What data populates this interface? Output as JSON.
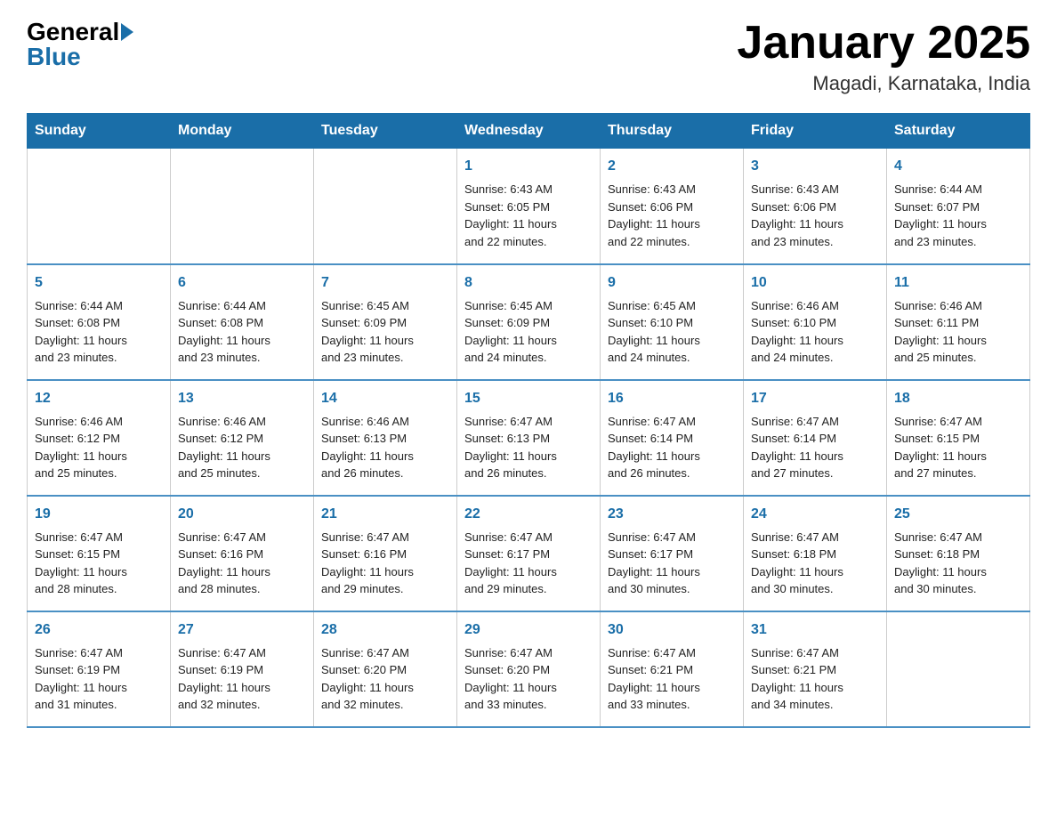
{
  "header": {
    "logo_general": "General",
    "logo_blue": "Blue",
    "month_title": "January 2025",
    "location": "Magadi, Karnataka, India"
  },
  "weekdays": [
    "Sunday",
    "Monday",
    "Tuesday",
    "Wednesday",
    "Thursday",
    "Friday",
    "Saturday"
  ],
  "weeks": [
    [
      {
        "day": "",
        "info": ""
      },
      {
        "day": "",
        "info": ""
      },
      {
        "day": "",
        "info": ""
      },
      {
        "day": "1",
        "info": "Sunrise: 6:43 AM\nSunset: 6:05 PM\nDaylight: 11 hours\nand 22 minutes."
      },
      {
        "day": "2",
        "info": "Sunrise: 6:43 AM\nSunset: 6:06 PM\nDaylight: 11 hours\nand 22 minutes."
      },
      {
        "day": "3",
        "info": "Sunrise: 6:43 AM\nSunset: 6:06 PM\nDaylight: 11 hours\nand 23 minutes."
      },
      {
        "day": "4",
        "info": "Sunrise: 6:44 AM\nSunset: 6:07 PM\nDaylight: 11 hours\nand 23 minutes."
      }
    ],
    [
      {
        "day": "5",
        "info": "Sunrise: 6:44 AM\nSunset: 6:08 PM\nDaylight: 11 hours\nand 23 minutes."
      },
      {
        "day": "6",
        "info": "Sunrise: 6:44 AM\nSunset: 6:08 PM\nDaylight: 11 hours\nand 23 minutes."
      },
      {
        "day": "7",
        "info": "Sunrise: 6:45 AM\nSunset: 6:09 PM\nDaylight: 11 hours\nand 23 minutes."
      },
      {
        "day": "8",
        "info": "Sunrise: 6:45 AM\nSunset: 6:09 PM\nDaylight: 11 hours\nand 24 minutes."
      },
      {
        "day": "9",
        "info": "Sunrise: 6:45 AM\nSunset: 6:10 PM\nDaylight: 11 hours\nand 24 minutes."
      },
      {
        "day": "10",
        "info": "Sunrise: 6:46 AM\nSunset: 6:10 PM\nDaylight: 11 hours\nand 24 minutes."
      },
      {
        "day": "11",
        "info": "Sunrise: 6:46 AM\nSunset: 6:11 PM\nDaylight: 11 hours\nand 25 minutes."
      }
    ],
    [
      {
        "day": "12",
        "info": "Sunrise: 6:46 AM\nSunset: 6:12 PM\nDaylight: 11 hours\nand 25 minutes."
      },
      {
        "day": "13",
        "info": "Sunrise: 6:46 AM\nSunset: 6:12 PM\nDaylight: 11 hours\nand 25 minutes."
      },
      {
        "day": "14",
        "info": "Sunrise: 6:46 AM\nSunset: 6:13 PM\nDaylight: 11 hours\nand 26 minutes."
      },
      {
        "day": "15",
        "info": "Sunrise: 6:47 AM\nSunset: 6:13 PM\nDaylight: 11 hours\nand 26 minutes."
      },
      {
        "day": "16",
        "info": "Sunrise: 6:47 AM\nSunset: 6:14 PM\nDaylight: 11 hours\nand 26 minutes."
      },
      {
        "day": "17",
        "info": "Sunrise: 6:47 AM\nSunset: 6:14 PM\nDaylight: 11 hours\nand 27 minutes."
      },
      {
        "day": "18",
        "info": "Sunrise: 6:47 AM\nSunset: 6:15 PM\nDaylight: 11 hours\nand 27 minutes."
      }
    ],
    [
      {
        "day": "19",
        "info": "Sunrise: 6:47 AM\nSunset: 6:15 PM\nDaylight: 11 hours\nand 28 minutes."
      },
      {
        "day": "20",
        "info": "Sunrise: 6:47 AM\nSunset: 6:16 PM\nDaylight: 11 hours\nand 28 minutes."
      },
      {
        "day": "21",
        "info": "Sunrise: 6:47 AM\nSunset: 6:16 PM\nDaylight: 11 hours\nand 29 minutes."
      },
      {
        "day": "22",
        "info": "Sunrise: 6:47 AM\nSunset: 6:17 PM\nDaylight: 11 hours\nand 29 minutes."
      },
      {
        "day": "23",
        "info": "Sunrise: 6:47 AM\nSunset: 6:17 PM\nDaylight: 11 hours\nand 30 minutes."
      },
      {
        "day": "24",
        "info": "Sunrise: 6:47 AM\nSunset: 6:18 PM\nDaylight: 11 hours\nand 30 minutes."
      },
      {
        "day": "25",
        "info": "Sunrise: 6:47 AM\nSunset: 6:18 PM\nDaylight: 11 hours\nand 30 minutes."
      }
    ],
    [
      {
        "day": "26",
        "info": "Sunrise: 6:47 AM\nSunset: 6:19 PM\nDaylight: 11 hours\nand 31 minutes."
      },
      {
        "day": "27",
        "info": "Sunrise: 6:47 AM\nSunset: 6:19 PM\nDaylight: 11 hours\nand 32 minutes."
      },
      {
        "day": "28",
        "info": "Sunrise: 6:47 AM\nSunset: 6:20 PM\nDaylight: 11 hours\nand 32 minutes."
      },
      {
        "day": "29",
        "info": "Sunrise: 6:47 AM\nSunset: 6:20 PM\nDaylight: 11 hours\nand 33 minutes."
      },
      {
        "day": "30",
        "info": "Sunrise: 6:47 AM\nSunset: 6:21 PM\nDaylight: 11 hours\nand 33 minutes."
      },
      {
        "day": "31",
        "info": "Sunrise: 6:47 AM\nSunset: 6:21 PM\nDaylight: 11 hours\nand 34 minutes."
      },
      {
        "day": "",
        "info": ""
      }
    ]
  ]
}
